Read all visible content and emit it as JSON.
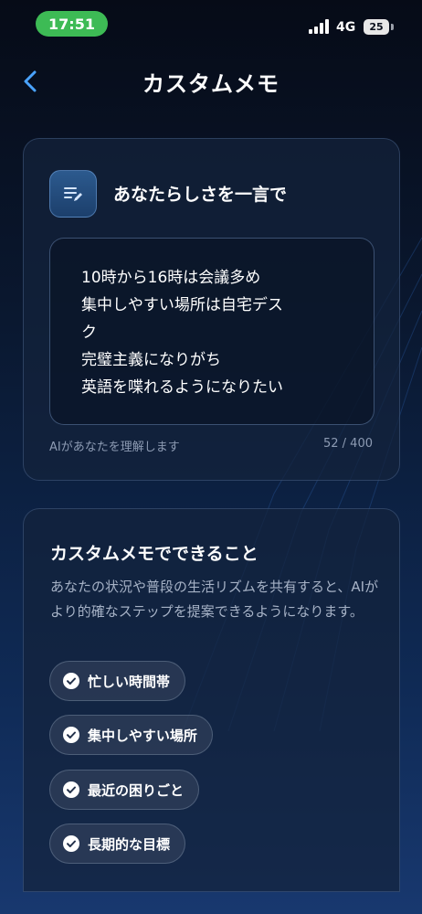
{
  "status_bar": {
    "time": "17:51",
    "network": "4G",
    "battery": "25"
  },
  "header": {
    "title": "カスタムメモ",
    "back_icon": "chevron-left-icon"
  },
  "memo_card": {
    "icon": "edit-note-icon",
    "heading": "あなたらしさを一言で",
    "memo_lines": [
      "10時から16時は会議多め",
      "集中しやすい場所は自宅デス",
      "ク",
      "完璧主義になりがち",
      "英語を喋れるようになりたい"
    ],
    "helper_text": "AIがあなたを理解します",
    "char_count": "52 / 400"
  },
  "info_card": {
    "title": "カスタムメモでできること",
    "description": "あなたの状況や普段の生活リズムを共有すると、AIがより的確なステップを提案できるようになります。",
    "chips": [
      "忙しい時間帯",
      "集中しやすい場所",
      "最近の困りごと",
      "長期的な目標"
    ]
  },
  "colors": {
    "time_pill": "#3dbb55",
    "accent_blue": "#4aa3ff"
  }
}
